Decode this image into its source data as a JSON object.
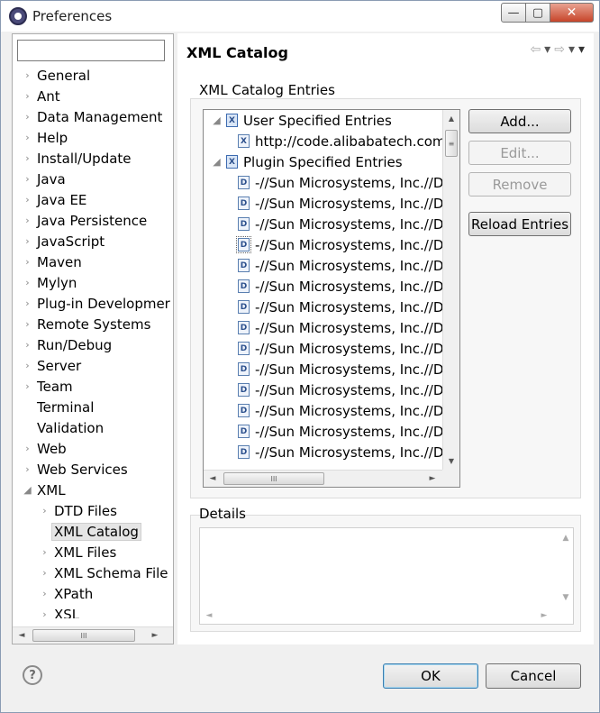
{
  "window": {
    "title": "Preferences",
    "min_glyph": "—",
    "max_glyph": "▢",
    "close_glyph": "✕",
    "icon": "eclipse-icon"
  },
  "left_panel": {
    "filter_value": "",
    "items": [
      {
        "label": "General",
        "twisty": "›",
        "level": 0
      },
      {
        "label": "Ant",
        "twisty": "›",
        "level": 0
      },
      {
        "label": "Data Management",
        "twisty": "›",
        "level": 0
      },
      {
        "label": "Help",
        "twisty": "›",
        "level": 0
      },
      {
        "label": "Install/Update",
        "twisty": "›",
        "level": 0
      },
      {
        "label": "Java",
        "twisty": "›",
        "level": 0
      },
      {
        "label": "Java EE",
        "twisty": "›",
        "level": 0
      },
      {
        "label": "Java Persistence",
        "twisty": "›",
        "level": 0
      },
      {
        "label": "JavaScript",
        "twisty": "›",
        "level": 0
      },
      {
        "label": "Maven",
        "twisty": "›",
        "level": 0
      },
      {
        "label": "Mylyn",
        "twisty": "›",
        "level": 0
      },
      {
        "label": "Plug-in Developmer",
        "twisty": "›",
        "level": 0
      },
      {
        "label": "Remote Systems",
        "twisty": "›",
        "level": 0
      },
      {
        "label": "Run/Debug",
        "twisty": "›",
        "level": 0
      },
      {
        "label": "Server",
        "twisty": "›",
        "level": 0
      },
      {
        "label": "Team",
        "twisty": "›",
        "level": 0
      },
      {
        "label": "Terminal",
        "twisty": "",
        "level": 0
      },
      {
        "label": "Validation",
        "twisty": "",
        "level": 0
      },
      {
        "label": "Web",
        "twisty": "›",
        "level": 0
      },
      {
        "label": "Web Services",
        "twisty": "›",
        "level": 0
      },
      {
        "label": "XML",
        "twisty": "◢",
        "level": 0
      },
      {
        "label": "DTD Files",
        "twisty": "›",
        "level": 1
      },
      {
        "label": "XML Catalog",
        "twisty": "",
        "level": 1,
        "selected": true
      },
      {
        "label": "XML Files",
        "twisty": "›",
        "level": 1
      },
      {
        "label": "XML Schema File",
        "twisty": "›",
        "level": 1
      },
      {
        "label": "XPath",
        "twisty": "›",
        "level": 1
      },
      {
        "label": "XSL",
        "twisty": "›",
        "level": 1
      }
    ],
    "hscroll": {
      "left": "◄",
      "right": "►",
      "thumb": "III"
    }
  },
  "page": {
    "title": "XML Catalog",
    "nav": {
      "back": "⇦",
      "back_menu": "▾",
      "forward": "⇨",
      "forward_menu": "▾",
      "menu": "▾"
    }
  },
  "catalog": {
    "group_label": "XML Catalog Entries",
    "entries": [
      {
        "label": "User Specified Entries",
        "twisty": "◢",
        "level": 0,
        "icon": "X"
      },
      {
        "label": "http://code.alibabatech.com/schema/dubbo",
        "twisty": "",
        "level": 1,
        "icon": "X"
      },
      {
        "label": "Plugin Specified Entries",
        "twisty": "◢",
        "level": 0,
        "icon": "X"
      },
      {
        "label": "-//Sun Microsystems, Inc.//DTD",
        "twisty": "",
        "level": 1,
        "icon": "D"
      },
      {
        "label": "-//Sun Microsystems, Inc.//DTD",
        "twisty": "",
        "level": 1,
        "icon": "D"
      },
      {
        "label": "-//Sun Microsystems, Inc.//DTD",
        "twisty": "",
        "level": 1,
        "icon": "D"
      },
      {
        "label": "-//Sun Microsystems, Inc.//DTD",
        "twisty": "",
        "level": 1,
        "icon": "D",
        "focused": true
      },
      {
        "label": "-//Sun Microsystems, Inc.//DTD",
        "twisty": "",
        "level": 1,
        "icon": "D"
      },
      {
        "label": "-//Sun Microsystems, Inc.//DTD",
        "twisty": "",
        "level": 1,
        "icon": "D"
      },
      {
        "label": "-//Sun Microsystems, Inc.//DTD",
        "twisty": "",
        "level": 1,
        "icon": "D"
      },
      {
        "label": "-//Sun Microsystems, Inc.//DTD",
        "twisty": "",
        "level": 1,
        "icon": "D"
      },
      {
        "label": "-//Sun Microsystems, Inc.//DTD",
        "twisty": "",
        "level": 1,
        "icon": "D"
      },
      {
        "label": "-//Sun Microsystems, Inc.//DTD",
        "twisty": "",
        "level": 1,
        "icon": "D"
      },
      {
        "label": "-//Sun Microsystems, Inc.//DTD",
        "twisty": "",
        "level": 1,
        "icon": "D"
      },
      {
        "label": "-//Sun Microsystems, Inc.//DTD",
        "twisty": "",
        "level": 1,
        "icon": "D"
      },
      {
        "label": "-//Sun Microsystems, Inc.//DTD",
        "twisty": "",
        "level": 1,
        "icon": "D"
      },
      {
        "label": "-//Sun Microsystems, Inc.//DTD",
        "twisty": "",
        "level": 1,
        "icon": "D"
      }
    ],
    "buttons": {
      "add": "Add...",
      "edit": "Edit...",
      "remove": "Remove",
      "reload": "Reload Entries"
    },
    "vscroll": {
      "up": "▲",
      "down": "▼",
      "thumb": "≡"
    },
    "hscroll": {
      "left": "◄",
      "right": "►",
      "thumb": "III"
    }
  },
  "details": {
    "group_label": "Details",
    "content": "",
    "vscroll": {
      "up": "▲",
      "down": "▼"
    },
    "hscroll": {
      "left": "◄",
      "right": "►"
    }
  },
  "footer": {
    "help_glyph": "?",
    "ok_label": "OK",
    "cancel_label": "Cancel"
  },
  "colors": {
    "window_bg": "#f0f0f0",
    "panel_bg": "#ffffff",
    "close_red": "#c7452a",
    "selection_bg": "#e5e5e5",
    "disabled_text": "#9a9a9a"
  }
}
